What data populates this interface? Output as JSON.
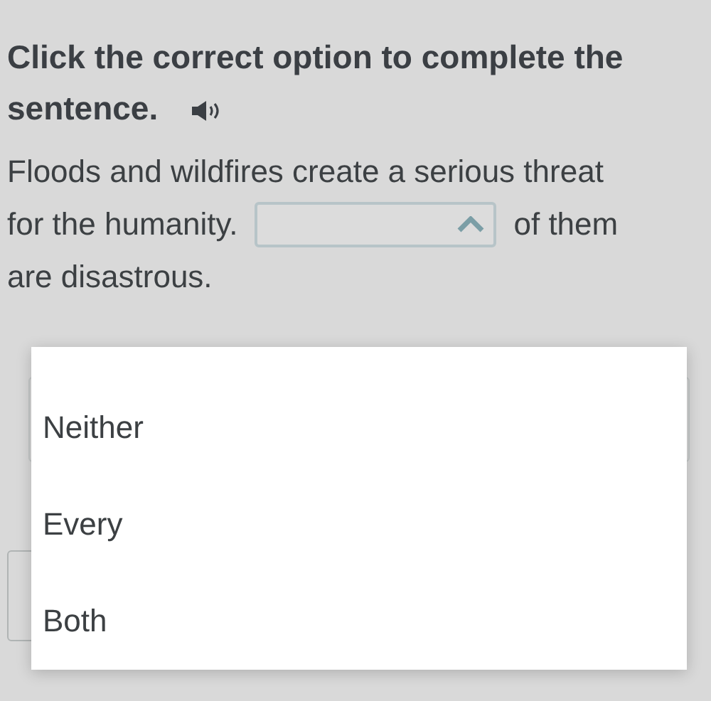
{
  "instruction": "Click the correct option to complete the sentence.",
  "sentence": {
    "before": [
      "Floods and wildfires create a serious threat",
      "for the humanity."
    ],
    "after": [
      "of them",
      "are disastrous."
    ]
  },
  "dropdown": {
    "expanded": true,
    "options": [
      {
        "label": "Neither",
        "selected": false
      },
      {
        "label": "Every",
        "selected": false
      },
      {
        "label": "Both",
        "selected": false
      }
    ]
  }
}
